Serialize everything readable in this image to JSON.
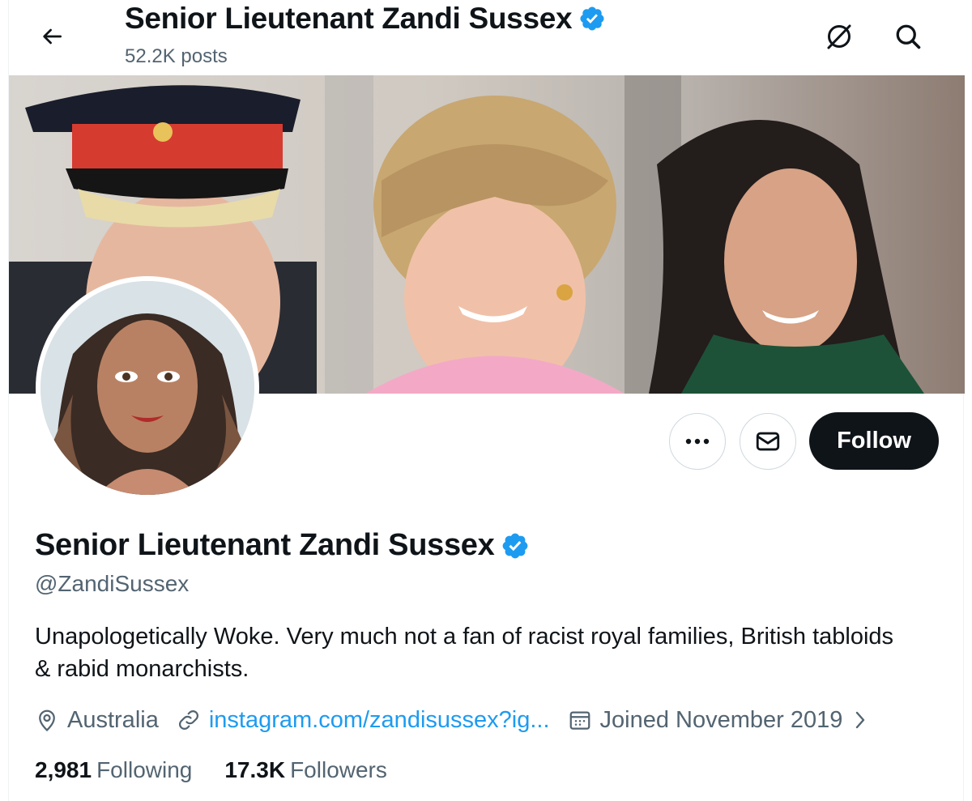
{
  "header": {
    "title": "Senior Lieutenant Zandi Sussex",
    "posts": "52.2K posts",
    "back_icon": "arrow-left-icon",
    "grok_icon": "grok-icon",
    "search_icon": "search-icon"
  },
  "profile": {
    "name": "Senior Lieutenant Zandi Sussex",
    "handle": "@ZandiSussex",
    "verified_badge": "verified-badge-icon",
    "bio": "Unapologetically Woke. Very much not a fan of racist royal families, British tabloids & rabid monarchists.",
    "location": "Australia",
    "link": "instagram.com/zandisussex?ig...",
    "joined": "Joined November 2019",
    "following_count": "2,981",
    "following_label": "Following",
    "followers_count": "17.3K",
    "followers_label": "Followers"
  },
  "actions": {
    "more_icon": "more-icon",
    "message_icon": "envelope-icon",
    "follow_label": "Follow"
  },
  "colors": {
    "accent": "#1d9bf0",
    "text": "#0f1419",
    "secondary": "#536471",
    "follow_bg": "#0f1419"
  }
}
